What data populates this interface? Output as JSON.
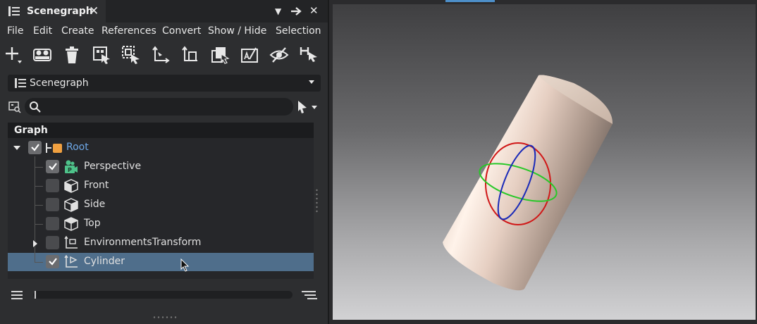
{
  "tab": {
    "title": "Scenegraph",
    "close": "✕"
  },
  "window_buttons": {
    "menu": "▼",
    "pin": "➔",
    "close": "✕"
  },
  "menu": [
    "File",
    "Edit",
    "Create",
    "References",
    "Convert",
    "Show / Hide",
    "Selection"
  ],
  "toolbar_icons": [
    "add-icon",
    "group-icon",
    "delete-icon",
    "select-icon",
    "select-children-icon",
    "transform-icon",
    "copy-transform-icon",
    "multi-select-icon",
    "rename-icon",
    "hide-icon",
    "isolate-icon"
  ],
  "dropdown": {
    "value": "Scenegraph"
  },
  "search": {
    "placeholder": ""
  },
  "graph": {
    "header": "Graph",
    "root": {
      "label": "Root",
      "color": "#f0a040",
      "label_color": "#6ea8e8"
    },
    "items": [
      {
        "label": "Perspective",
        "checked": true,
        "icon": "camera-icon"
      },
      {
        "label": "Front",
        "checked": false,
        "icon": "cube-icon"
      },
      {
        "label": "Side",
        "checked": false,
        "icon": "cube-icon"
      },
      {
        "label": "Top",
        "checked": false,
        "icon": "cube-icon"
      },
      {
        "label": "EnvironmentsTransform",
        "checked": false,
        "icon": "transform-node-icon"
      },
      {
        "label": "Cylinder",
        "checked": true,
        "icon": "transform-node-icon",
        "selected": true
      }
    ]
  },
  "colors": {
    "accent": "#4d8fc9",
    "selection": "#4f6e8b",
    "gizmo_x": "#d01818",
    "gizmo_y": "#28c828",
    "gizmo_z": "#1a2ab8"
  }
}
